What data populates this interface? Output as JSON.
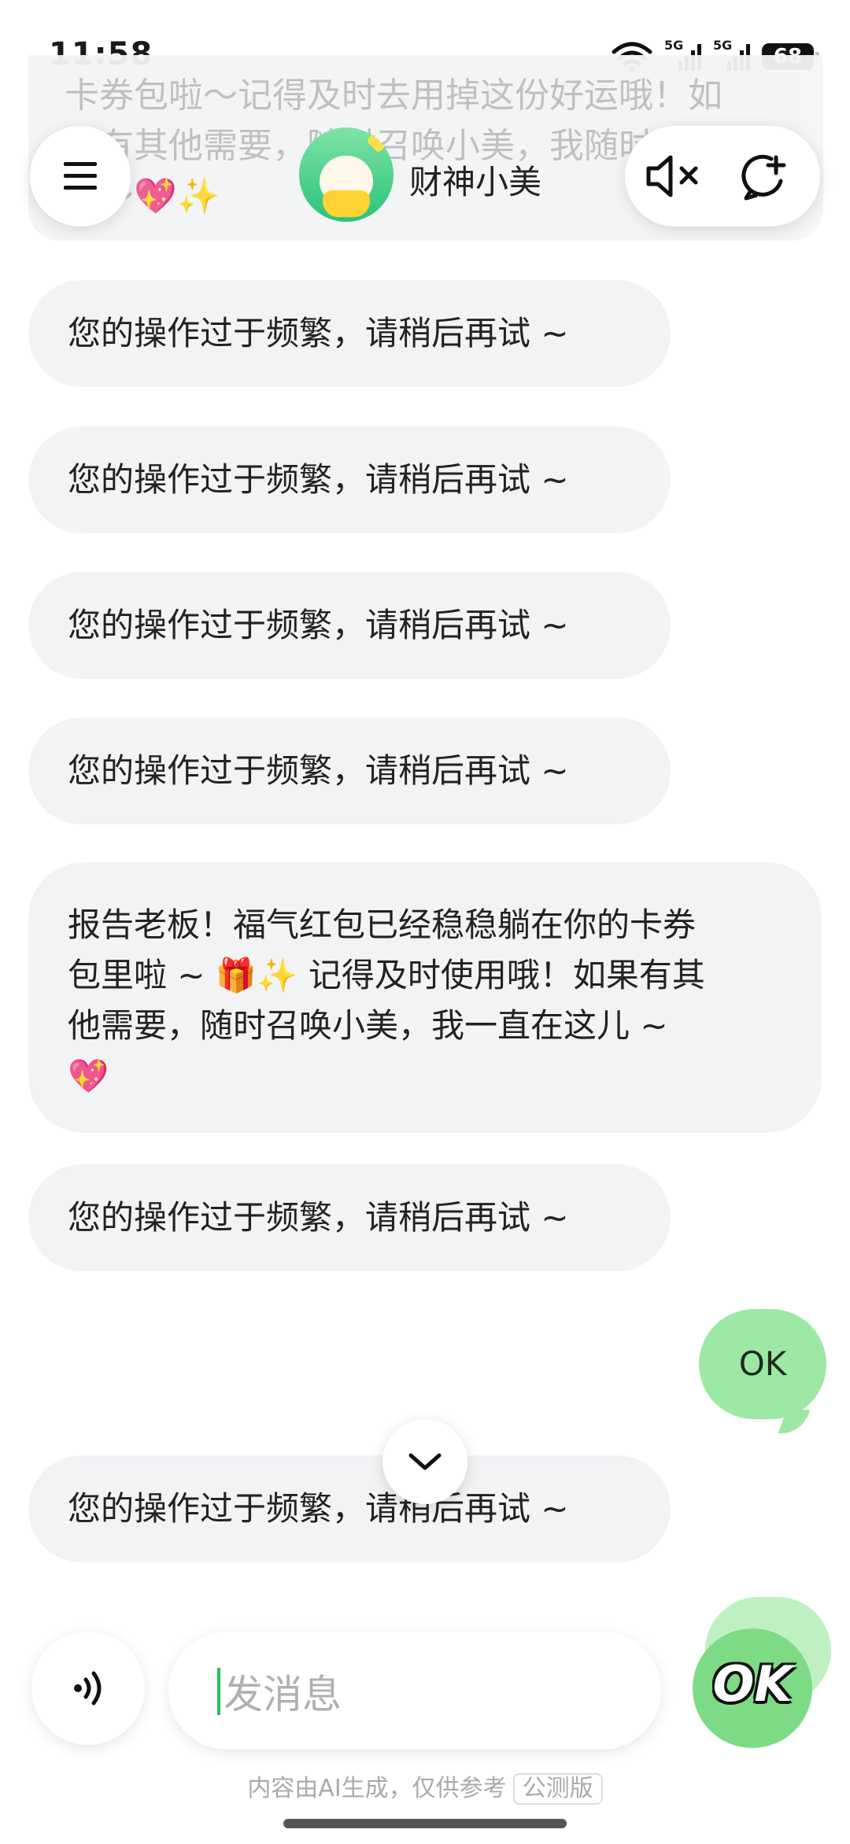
{
  "status_bar": {
    "time": "11:58",
    "battery": "68",
    "network_1": "5G",
    "network_2": "5G"
  },
  "header": {
    "bot_name": "财神小美"
  },
  "top_faded": {
    "lines": [
      "卡券包啦～记得及时去用掉这份好运哦！如",
      "果有其他需要，随时召唤小美，我随时待",
      "命～💖✨"
    ]
  },
  "messages": [
    {
      "from": "bot",
      "text": "您的操作过于频繁，请稍后再试 ~"
    },
    {
      "from": "bot",
      "text": "您的操作过于频繁，请稍后再试 ~"
    },
    {
      "from": "bot",
      "text": "您的操作过于频繁，请稍后再试 ~"
    },
    {
      "from": "bot",
      "text": "您的操作过于频繁，请稍后再试 ~"
    },
    {
      "from": "bot",
      "lines": [
        "报告老板！福气红包已经稳稳躺在你的卡券",
        "包里啦 ~ 🎁✨ 记得及时使用哦！如果有其",
        "他需要，随时召唤小美，我一直在这儿 ~",
        "💖"
      ]
    },
    {
      "from": "bot",
      "text": "您的操作过于频繁，请稍后再试 ~"
    },
    {
      "from": "user",
      "text": "OK"
    },
    {
      "from": "bot",
      "text": "您的操作过于频繁，请稍后再试 ~"
    }
  ],
  "input": {
    "placeholder": "发消息"
  },
  "sticker": {
    "text": "OK"
  },
  "footer": {
    "disclaimer": "内容由AI生成，仅供参考",
    "badge": "公测版"
  },
  "icons": {
    "menu": "menu-icon",
    "mute": "speaker-mute-icon",
    "new_chat": "new-chat-icon",
    "scroll": "chevron-down-icon",
    "voice": "voice-wave-icon"
  },
  "colors": {
    "bot_bubble": "#f2f3f5",
    "user_bubble": "#9ee8a5",
    "accent": "#2cbf5a"
  }
}
